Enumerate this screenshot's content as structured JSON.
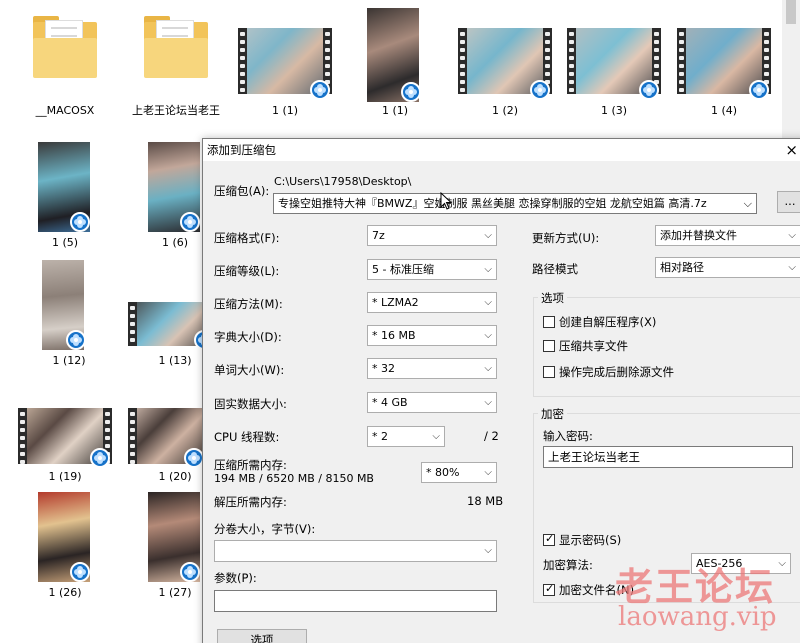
{
  "desktop": {
    "folders": [
      {
        "name": "__MACOSX"
      },
      {
        "name": "上老王论坛当老王"
      }
    ],
    "videos": [
      {
        "label": "1 (1)"
      },
      {
        "label": "1 (1)"
      },
      {
        "label": "1 (2)"
      },
      {
        "label": "1 (3)"
      },
      {
        "label": "1 (4)"
      },
      {
        "label": "1 (5)"
      },
      {
        "label": "1 (6)"
      },
      {
        "label": "1 (12)"
      },
      {
        "label": "1 (13)"
      },
      {
        "label": "1 (19)"
      },
      {
        "label": "1 (20)"
      },
      {
        "label": "1 (26)"
      },
      {
        "label": "1 (27)"
      }
    ]
  },
  "dialog": {
    "title": "添加到压缩包",
    "archive_label": "压缩包(A):",
    "archive_path": "C:\\Users\\17958\\Desktop\\",
    "archive_name": "专操空姐推特大神『BMWZ』空姐制服 黑丝美腿 恋操穿制服的空姐 龙航空姐篇 高清.7z",
    "browse_label": "...",
    "format_label": "压缩格式(F):",
    "format_value": "7z",
    "level_label": "压缩等级(L):",
    "level_value": "5 - 标准压缩",
    "method_label": "压缩方法(M):",
    "method_value": "* LZMA2",
    "dict_label": "字典大小(D):",
    "dict_value": "* 16 MB",
    "word_label": "单词大小(W):",
    "word_value": "* 32",
    "solid_label": "固实数据大小:",
    "solid_value": "* 4 GB",
    "cpu_label": "CPU 线程数:",
    "cpu_value": "* 2",
    "cpu_total": "/ 2",
    "mem_label": "压缩所需内存:",
    "mem_detail": "194 MB / 6520 MB / 8150 MB",
    "mem_value": "* 80%",
    "decomp_label": "解压所需内存:",
    "decomp_value": "18 MB",
    "volume_label": "分卷大小，字节(V):",
    "volume_value": "",
    "params_label": "参数(P):",
    "params_value": "",
    "options_button": "选项",
    "update_label": "更新方式(U):",
    "update_value": "添加并替换文件",
    "path_label": "路径模式",
    "path_value": "相对路径",
    "options_group": "选项",
    "opt_sfx": "创建自解压程序(X)",
    "opt_shared": "压缩共享文件",
    "opt_delete": "操作完成后删除源文件",
    "encrypt_group": "加密",
    "password_label": "输入密码:",
    "password_value": "上老王论坛当老王",
    "show_password": "显示密码(S)",
    "enc_method_label": "加密算法:",
    "enc_method_value": "AES-256",
    "enc_names": "加密文件名(N)"
  },
  "watermark": {
    "cn": "老王论坛",
    "url": "laowang.vip"
  }
}
